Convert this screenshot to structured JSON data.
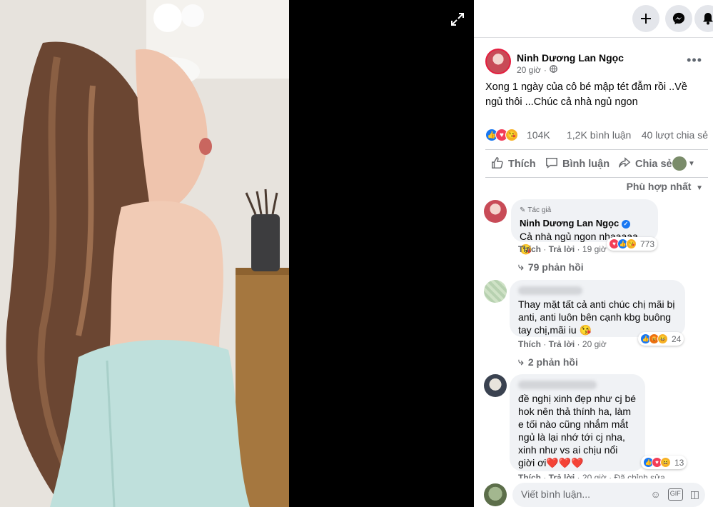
{
  "viewer": {
    "expand_icon": "expand-arrows-icon"
  },
  "topbar": {
    "buttons": [
      "plus-icon",
      "messenger-icon",
      "bell-icon"
    ]
  },
  "post": {
    "author": "Ninh Dương Lan Ngọc",
    "time": "20 giờ",
    "privacy_icon": "globe-icon",
    "text": "Xong 1 ngày của cô bé mập tét đẫm rồi ..Về ngủ thôi ...Chúc cả nhà ngủ ngon",
    "reaction_count": "104K",
    "comment_count": "1,2K bình luận",
    "share_count": "40 lượt chia sẻ",
    "actions": {
      "like": "Thích",
      "comment": "Bình luận",
      "share": "Chia sẻ"
    },
    "sort_label": "Phù hợp nhất"
  },
  "comments": [
    {
      "badge": "Tác giả",
      "name": "Ninh Dương Lan Ngọc",
      "text": "Cả nhà ngủ ngon nhaaaaa 😘",
      "like": "Thích",
      "reply": "Trả lời",
      "time": "19 giờ",
      "reactions": "773",
      "replies": "79 phản hồi"
    },
    {
      "text": "Thay mặt tất cả anti chúc chị mãi bị anti, anti luôn bên cạnh kbg buông tay chị,mãi iu 😘",
      "like": "Thích",
      "reply": "Trả lời",
      "time": "20 giờ",
      "reactions": "24",
      "replies": "2 phản hồi"
    },
    {
      "text": "đề nghị xinh đẹp như cj bé hok nên thả thính ha, làm e tối nào cũng nhắm mắt ngủ là lại nhớ tới cj nha, xinh như vs ai chịu nổi giời ơi❤️❤️❤️",
      "like": "Thích",
      "reply": "Trả lời",
      "time": "20 giờ",
      "edited": "Đã chỉnh sửa",
      "reactions": "13"
    }
  ],
  "composer": {
    "placeholder": "Viết bình luận..."
  },
  "colors": {
    "accent": "#1877f2",
    "love": "#f33e58",
    "bubble": "#f0f2f5"
  }
}
